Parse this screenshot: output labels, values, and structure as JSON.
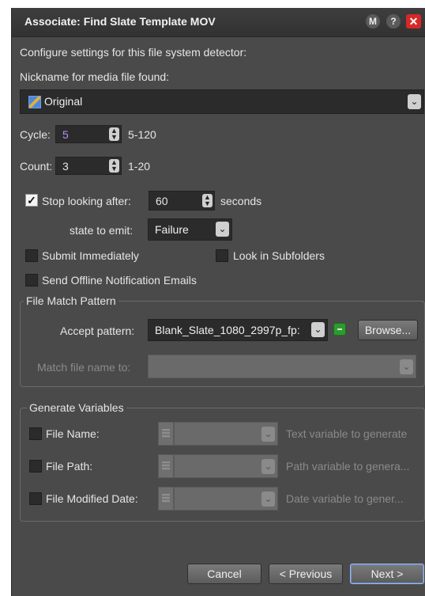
{
  "window": {
    "title": "Associate: Find Slate Template MOV",
    "buttons": {
      "m": "M",
      "help": "?",
      "close": "✕"
    }
  },
  "intro": "Configure settings for this file system detector:",
  "nickname": {
    "label": "Nickname for media file found:",
    "value": "Original"
  },
  "cycle": {
    "label": "Cycle:",
    "value": "5",
    "range": "5-120"
  },
  "count": {
    "label": "Count:",
    "value": "3",
    "range": "1-20"
  },
  "stop_looking": {
    "checked": true,
    "label": "Stop looking after:",
    "value": "60",
    "unit": "seconds"
  },
  "state_to_emit": {
    "label": "state to emit:",
    "value": "Failure"
  },
  "submit_immediately": {
    "checked": false,
    "label": "Submit Immediately"
  },
  "look_in_subfolders": {
    "checked": false,
    "label": "Look in Subfolders"
  },
  "send_offline": {
    "checked": false,
    "label": "Send Offline Notification Emails"
  },
  "file_match": {
    "legend": "File Match Pattern",
    "accept_label": "Accept pattern:",
    "accept_value": "Blank_Slate_1080_2997p_fp:",
    "browse": "Browse...",
    "match_name_label": "Match file name to:"
  },
  "generate_variables": {
    "legend": "Generate Variables",
    "rows": [
      {
        "label": "File Name:",
        "placeholder": "Text variable to generate"
      },
      {
        "label": "File Path:",
        "placeholder": "Path variable to genera..."
      },
      {
        "label": "File Modified Date:",
        "placeholder": "Date variable to gener..."
      }
    ]
  },
  "footer": {
    "cancel": "Cancel",
    "previous": "< Previous",
    "next": "Next >"
  }
}
